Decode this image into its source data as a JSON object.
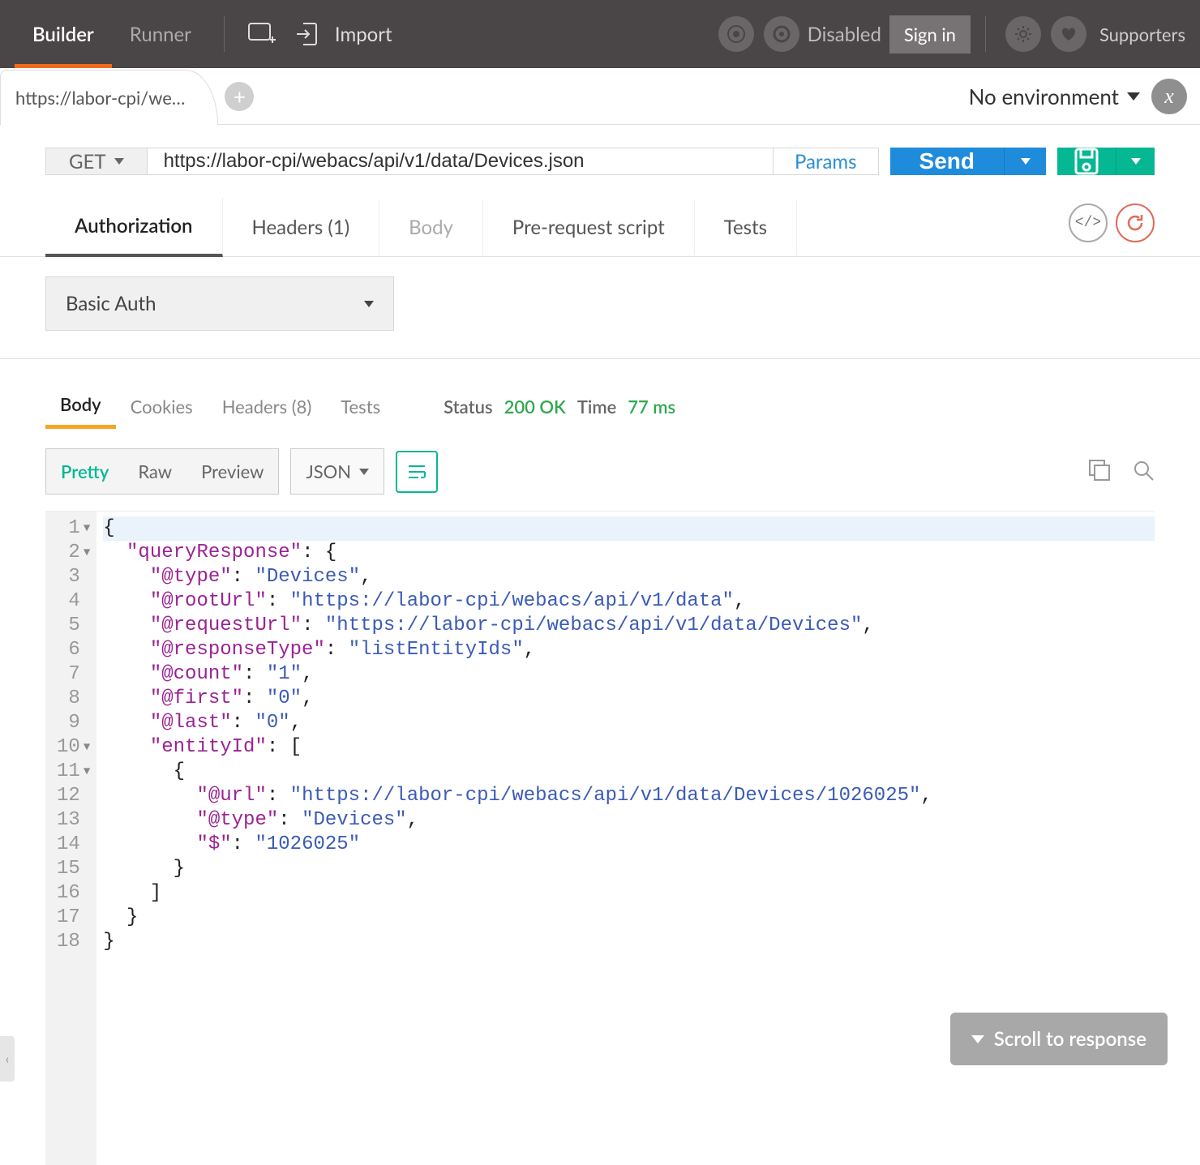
{
  "topbar": {
    "builder": "Builder",
    "runner": "Runner",
    "import": "Import",
    "disabled": "Disabled",
    "signin": "Sign in",
    "supporters": "Supporters"
  },
  "tabs": {
    "active_tab": "https://labor-cpi/we…"
  },
  "environment": {
    "label": "No environment"
  },
  "request": {
    "method": "GET",
    "url": "https://labor-cpi/webacs/api/v1/data/Devices.json",
    "params": "Params",
    "send": "Send"
  },
  "request_tabs": {
    "authorization": "Authorization",
    "headers": "Headers (1)",
    "body": "Body",
    "prerequest": "Pre-request script",
    "tests": "Tests"
  },
  "auth": {
    "type": "Basic Auth"
  },
  "response_tabs": {
    "body": "Body",
    "cookies": "Cookies",
    "headers": "Headers (8)",
    "tests": "Tests"
  },
  "response_status": {
    "status_label": "Status",
    "status_value": "200 OK",
    "time_label": "Time",
    "time_value": "77 ms"
  },
  "view_modes": {
    "pretty": "Pretty",
    "raw": "Raw",
    "preview": "Preview",
    "format": "JSON"
  },
  "code": {
    "lines": [
      {
        "n": "1",
        "fold": true,
        "indent": 0,
        "type": "punc",
        "text": "{"
      },
      {
        "n": "2",
        "fold": true,
        "indent": 1,
        "type": "kv_open",
        "key": "\"queryResponse\"",
        "sep": ": ",
        "open": "{"
      },
      {
        "n": "3",
        "indent": 2,
        "type": "kv",
        "key": "\"@type\"",
        "sep": ": ",
        "val": "\"Devices\"",
        "comma": ","
      },
      {
        "n": "4",
        "indent": 2,
        "type": "kv",
        "key": "\"@rootUrl\"",
        "sep": ": ",
        "val": "\"https://labor-cpi/webacs/api/v1/data\"",
        "comma": ","
      },
      {
        "n": "5",
        "indent": 2,
        "type": "kv",
        "key": "\"@requestUrl\"",
        "sep": ": ",
        "val": "\"https://labor-cpi/webacs/api/v1/data/Devices\"",
        "comma": ","
      },
      {
        "n": "6",
        "indent": 2,
        "type": "kv",
        "key": "\"@responseType\"",
        "sep": ": ",
        "val": "\"listEntityIds\"",
        "comma": ","
      },
      {
        "n": "7",
        "indent": 2,
        "type": "kv",
        "key": "\"@count\"",
        "sep": ": ",
        "val": "\"1\"",
        "comma": ","
      },
      {
        "n": "8",
        "indent": 2,
        "type": "kv",
        "key": "\"@first\"",
        "sep": ": ",
        "val": "\"0\"",
        "comma": ","
      },
      {
        "n": "9",
        "indent": 2,
        "type": "kv",
        "key": "\"@last\"",
        "sep": ": ",
        "val": "\"0\"",
        "comma": ","
      },
      {
        "n": "10",
        "fold": true,
        "indent": 2,
        "type": "kv_open",
        "key": "\"entityId\"",
        "sep": ": ",
        "open": "["
      },
      {
        "n": "11",
        "fold": true,
        "indent": 3,
        "type": "punc",
        "text": "{"
      },
      {
        "n": "12",
        "indent": 4,
        "type": "kv",
        "key": "\"@url\"",
        "sep": ": ",
        "val": "\"https://labor-cpi/webacs/api/v1/data/Devices/1026025\"",
        "comma": ","
      },
      {
        "n": "13",
        "indent": 4,
        "type": "kv",
        "key": "\"@type\"",
        "sep": ": ",
        "val": "\"Devices\"",
        "comma": ","
      },
      {
        "n": "14",
        "indent": 4,
        "type": "kv",
        "key": "\"$\"",
        "sep": ": ",
        "val": "\"1026025\"",
        "comma": ""
      },
      {
        "n": "15",
        "indent": 3,
        "type": "punc",
        "text": "}"
      },
      {
        "n": "16",
        "indent": 2,
        "type": "punc",
        "text": "]"
      },
      {
        "n": "17",
        "indent": 1,
        "type": "punc",
        "text": "}"
      },
      {
        "n": "18",
        "indent": 0,
        "type": "punc",
        "text": "}"
      }
    ]
  },
  "scroll_button": "Scroll to response"
}
